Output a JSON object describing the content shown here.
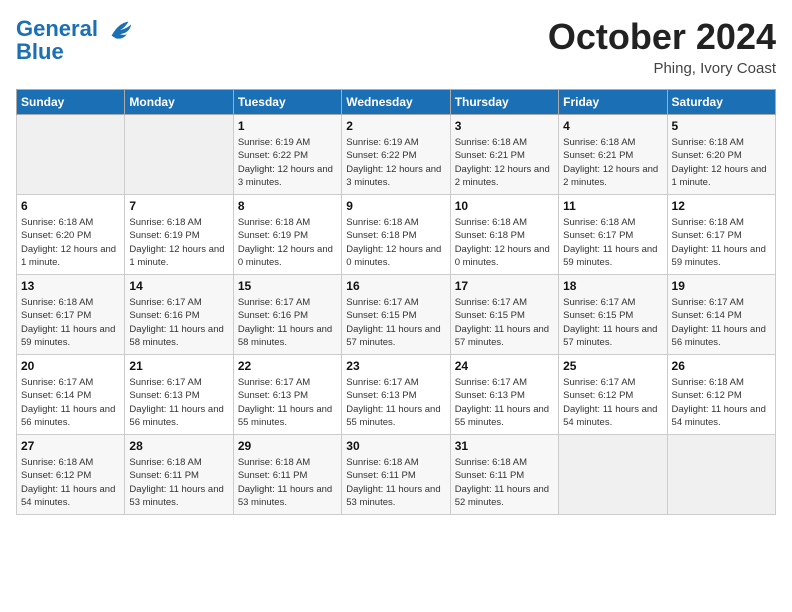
{
  "header": {
    "logo_line1": "General",
    "logo_line2": "Blue",
    "month": "October 2024",
    "location": "Phing, Ivory Coast"
  },
  "weekdays": [
    "Sunday",
    "Monday",
    "Tuesday",
    "Wednesday",
    "Thursday",
    "Friday",
    "Saturday"
  ],
  "weeks": [
    [
      {
        "day": "",
        "sunrise": "",
        "sunset": "",
        "daylight": ""
      },
      {
        "day": "",
        "sunrise": "",
        "sunset": "",
        "daylight": ""
      },
      {
        "day": "1",
        "sunrise": "Sunrise: 6:19 AM",
        "sunset": "Sunset: 6:22 PM",
        "daylight": "Daylight: 12 hours and 3 minutes."
      },
      {
        "day": "2",
        "sunrise": "Sunrise: 6:19 AM",
        "sunset": "Sunset: 6:22 PM",
        "daylight": "Daylight: 12 hours and 3 minutes."
      },
      {
        "day": "3",
        "sunrise": "Sunrise: 6:18 AM",
        "sunset": "Sunset: 6:21 PM",
        "daylight": "Daylight: 12 hours and 2 minutes."
      },
      {
        "day": "4",
        "sunrise": "Sunrise: 6:18 AM",
        "sunset": "Sunset: 6:21 PM",
        "daylight": "Daylight: 12 hours and 2 minutes."
      },
      {
        "day": "5",
        "sunrise": "Sunrise: 6:18 AM",
        "sunset": "Sunset: 6:20 PM",
        "daylight": "Daylight: 12 hours and 1 minute."
      }
    ],
    [
      {
        "day": "6",
        "sunrise": "Sunrise: 6:18 AM",
        "sunset": "Sunset: 6:20 PM",
        "daylight": "Daylight: 12 hours and 1 minute."
      },
      {
        "day": "7",
        "sunrise": "Sunrise: 6:18 AM",
        "sunset": "Sunset: 6:19 PM",
        "daylight": "Daylight: 12 hours and 1 minute."
      },
      {
        "day": "8",
        "sunrise": "Sunrise: 6:18 AM",
        "sunset": "Sunset: 6:19 PM",
        "daylight": "Daylight: 12 hours and 0 minutes."
      },
      {
        "day": "9",
        "sunrise": "Sunrise: 6:18 AM",
        "sunset": "Sunset: 6:18 PM",
        "daylight": "Daylight: 12 hours and 0 minutes."
      },
      {
        "day": "10",
        "sunrise": "Sunrise: 6:18 AM",
        "sunset": "Sunset: 6:18 PM",
        "daylight": "Daylight: 12 hours and 0 minutes."
      },
      {
        "day": "11",
        "sunrise": "Sunrise: 6:18 AM",
        "sunset": "Sunset: 6:17 PM",
        "daylight": "Daylight: 11 hours and 59 minutes."
      },
      {
        "day": "12",
        "sunrise": "Sunrise: 6:18 AM",
        "sunset": "Sunset: 6:17 PM",
        "daylight": "Daylight: 11 hours and 59 minutes."
      }
    ],
    [
      {
        "day": "13",
        "sunrise": "Sunrise: 6:18 AM",
        "sunset": "Sunset: 6:17 PM",
        "daylight": "Daylight: 11 hours and 59 minutes."
      },
      {
        "day": "14",
        "sunrise": "Sunrise: 6:17 AM",
        "sunset": "Sunset: 6:16 PM",
        "daylight": "Daylight: 11 hours and 58 minutes."
      },
      {
        "day": "15",
        "sunrise": "Sunrise: 6:17 AM",
        "sunset": "Sunset: 6:16 PM",
        "daylight": "Daylight: 11 hours and 58 minutes."
      },
      {
        "day": "16",
        "sunrise": "Sunrise: 6:17 AM",
        "sunset": "Sunset: 6:15 PM",
        "daylight": "Daylight: 11 hours and 57 minutes."
      },
      {
        "day": "17",
        "sunrise": "Sunrise: 6:17 AM",
        "sunset": "Sunset: 6:15 PM",
        "daylight": "Daylight: 11 hours and 57 minutes."
      },
      {
        "day": "18",
        "sunrise": "Sunrise: 6:17 AM",
        "sunset": "Sunset: 6:15 PM",
        "daylight": "Daylight: 11 hours and 57 minutes."
      },
      {
        "day": "19",
        "sunrise": "Sunrise: 6:17 AM",
        "sunset": "Sunset: 6:14 PM",
        "daylight": "Daylight: 11 hours and 56 minutes."
      }
    ],
    [
      {
        "day": "20",
        "sunrise": "Sunrise: 6:17 AM",
        "sunset": "Sunset: 6:14 PM",
        "daylight": "Daylight: 11 hours and 56 minutes."
      },
      {
        "day": "21",
        "sunrise": "Sunrise: 6:17 AM",
        "sunset": "Sunset: 6:13 PM",
        "daylight": "Daylight: 11 hours and 56 minutes."
      },
      {
        "day": "22",
        "sunrise": "Sunrise: 6:17 AM",
        "sunset": "Sunset: 6:13 PM",
        "daylight": "Daylight: 11 hours and 55 minutes."
      },
      {
        "day": "23",
        "sunrise": "Sunrise: 6:17 AM",
        "sunset": "Sunset: 6:13 PM",
        "daylight": "Daylight: 11 hours and 55 minutes."
      },
      {
        "day": "24",
        "sunrise": "Sunrise: 6:17 AM",
        "sunset": "Sunset: 6:13 PM",
        "daylight": "Daylight: 11 hours and 55 minutes."
      },
      {
        "day": "25",
        "sunrise": "Sunrise: 6:17 AM",
        "sunset": "Sunset: 6:12 PM",
        "daylight": "Daylight: 11 hours and 54 minutes."
      },
      {
        "day": "26",
        "sunrise": "Sunrise: 6:18 AM",
        "sunset": "Sunset: 6:12 PM",
        "daylight": "Daylight: 11 hours and 54 minutes."
      }
    ],
    [
      {
        "day": "27",
        "sunrise": "Sunrise: 6:18 AM",
        "sunset": "Sunset: 6:12 PM",
        "daylight": "Daylight: 11 hours and 54 minutes."
      },
      {
        "day": "28",
        "sunrise": "Sunrise: 6:18 AM",
        "sunset": "Sunset: 6:11 PM",
        "daylight": "Daylight: 11 hours and 53 minutes."
      },
      {
        "day": "29",
        "sunrise": "Sunrise: 6:18 AM",
        "sunset": "Sunset: 6:11 PM",
        "daylight": "Daylight: 11 hours and 53 minutes."
      },
      {
        "day": "30",
        "sunrise": "Sunrise: 6:18 AM",
        "sunset": "Sunset: 6:11 PM",
        "daylight": "Daylight: 11 hours and 53 minutes."
      },
      {
        "day": "31",
        "sunrise": "Sunrise: 6:18 AM",
        "sunset": "Sunset: 6:11 PM",
        "daylight": "Daylight: 11 hours and 52 minutes."
      },
      {
        "day": "",
        "sunrise": "",
        "sunset": "",
        "daylight": ""
      },
      {
        "day": "",
        "sunrise": "",
        "sunset": "",
        "daylight": ""
      }
    ]
  ]
}
